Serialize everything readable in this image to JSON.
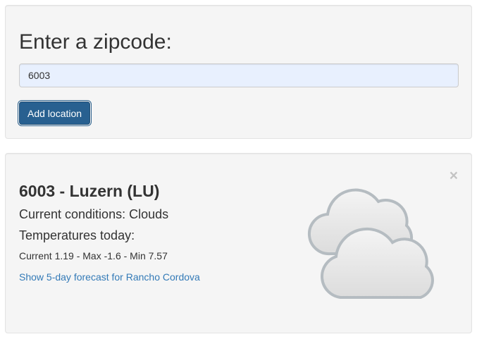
{
  "zip_panel": {
    "heading": "Enter a zipcode:",
    "input_value": "6003",
    "button_label": "Add location"
  },
  "location_card": {
    "close_label": "×",
    "title": "6003 - Luzern (LU)",
    "conditions": "Current conditions: Clouds",
    "temps_heading": "Temperatures today:",
    "temps_line": "Current 1.19 - Max -1.6 - Min 7.57",
    "forecast_link": "Show 5-day forecast for Rancho Cordova",
    "weather_icon": "clouds-icon"
  },
  "colors": {
    "primary_button": "#286090",
    "link": "#337ab7",
    "panel_bg": "#f5f5f5",
    "input_bg": "#e8f0fe"
  }
}
